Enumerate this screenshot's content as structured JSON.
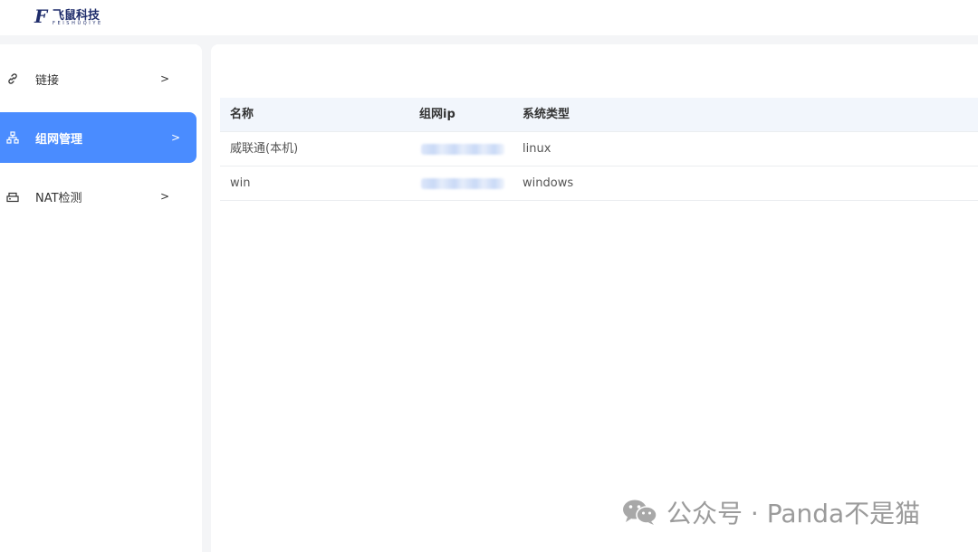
{
  "brand": {
    "mark": "F",
    "name": "飞鼠科技",
    "subtitle": "FEISHUQIYE"
  },
  "sidebar": {
    "items": [
      {
        "label": "链接",
        "icon": "link-icon",
        "arrow": ">",
        "active": false
      },
      {
        "label": "组网管理",
        "icon": "network-icon",
        "arrow": ">",
        "active": true
      },
      {
        "label": "NAT检测",
        "icon": "router-icon",
        "arrow": ">",
        "active": false
      }
    ]
  },
  "table": {
    "columns": [
      "名称",
      "组网ip",
      "系统类型"
    ],
    "rows": [
      {
        "name": "威联通(本机)",
        "ip": "",
        "type": "linux"
      },
      {
        "name": "win",
        "ip": "",
        "type": "windows"
      }
    ]
  },
  "watermark": {
    "icon": "wechat-icon",
    "text": "公众号 · Panda不是猫"
  },
  "colors": {
    "accent": "#4a8cff",
    "brand": "#1f2d6b"
  }
}
